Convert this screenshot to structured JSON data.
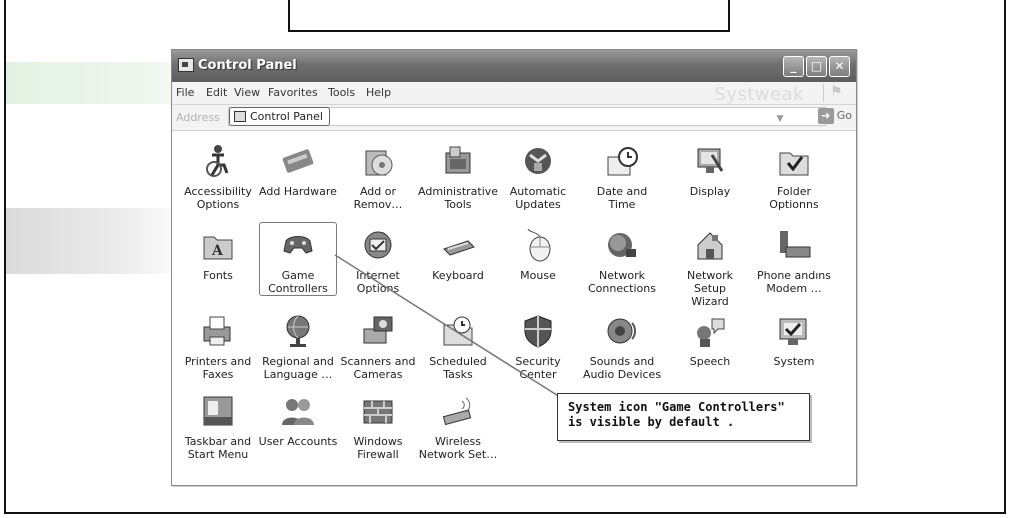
{
  "window": {
    "title": "Control Panel",
    "buttons": {
      "minimize": "_",
      "maximize": "□",
      "close": "✕"
    }
  },
  "menu": {
    "items": [
      "File",
      "Edit",
      "View",
      "Favorites",
      "Tools",
      "Help"
    ],
    "brand": "Systweak"
  },
  "address": {
    "label": "Address",
    "value": "Control Panel",
    "go_label": "Go"
  },
  "icons": [
    {
      "label": "Accessibility\nOptions",
      "icon": "accessibility-icon"
    },
    {
      "label": "Add Hardware",
      "icon": "add-hardware-icon"
    },
    {
      "label": "Add or\nRemov…",
      "icon": "add-remove-programs-icon"
    },
    {
      "label": "Administrative\nTools",
      "icon": "administrative-tools-icon"
    },
    {
      "label": "Automatic\nUpdates",
      "icon": "automatic-updates-icon"
    },
    {
      "label": "Date and Time",
      "icon": "date-time-icon"
    },
    {
      "label": "Display",
      "icon": "display-icon"
    },
    {
      "label": "Folder Optionns",
      "icon": "folder-options-icon"
    },
    {
      "label": "Fonts",
      "icon": "fonts-icon"
    },
    {
      "label": "Game\nControllers",
      "icon": "game-controllers-icon"
    },
    {
      "label": "Internet\nOptions",
      "icon": "internet-options-icon"
    },
    {
      "label": "Keyboard",
      "icon": "keyboard-icon"
    },
    {
      "label": "Mouse",
      "icon": "mouse-icon"
    },
    {
      "label": "Network\nConnections",
      "icon": "network-connections-icon"
    },
    {
      "label": "Network Setup\nWizard",
      "icon": "network-setup-wizard-icon"
    },
    {
      "label": "Phone andıns\nModem …",
      "icon": "phone-modem-icon"
    },
    {
      "label": "Printers and\nFaxes",
      "icon": "printers-faxes-icon"
    },
    {
      "label": "Regional and\nLanguage …",
      "icon": "regional-language-icon"
    },
    {
      "label": "Scanners and\nCameras",
      "icon": "scanners-cameras-icon"
    },
    {
      "label": "Scheduled\nTasks",
      "icon": "scheduled-tasks-icon"
    },
    {
      "label": "Security\nCenter",
      "icon": "security-center-icon"
    },
    {
      "label": "Sounds and\nAudio Devices",
      "icon": "sounds-audio-icon"
    },
    {
      "label": "Speech",
      "icon": "speech-icon"
    },
    {
      "label": "System",
      "icon": "system-icon"
    },
    {
      "label": "Taskbar and\nStart Menu",
      "icon": "taskbar-start-menu-icon"
    },
    {
      "label": "User Accounts",
      "icon": "user-accounts-icon"
    },
    {
      "label": "Windows\nFirewall",
      "icon": "windows-firewall-icon"
    },
    {
      "label": "Wireless\nNetwork Set…",
      "icon": "wireless-network-icon"
    }
  ],
  "callout": {
    "line1": "System icon \"Game Controllers\"",
    "line2": "is visible by default ."
  }
}
